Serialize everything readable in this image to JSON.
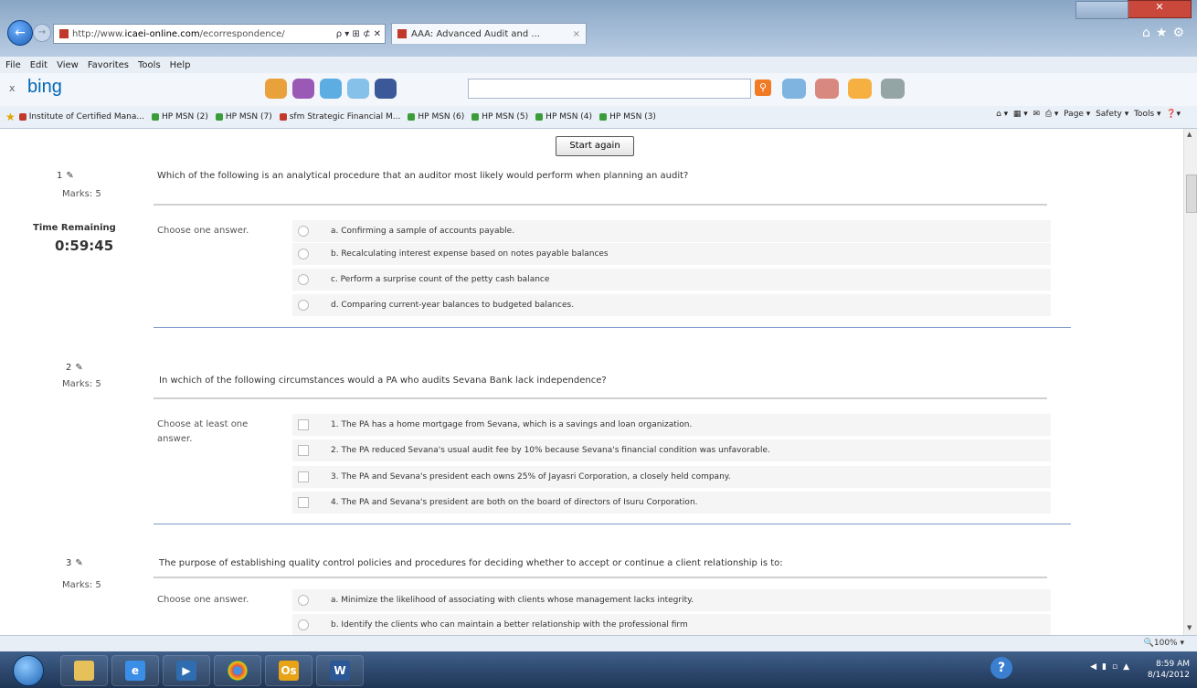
{
  "browser": {
    "url_prefix": "http://www.",
    "url_domain": "icaei-online.com",
    "url_path": "/ecorrespondence/",
    "url_controls": "ρ ▾ ⊞ ⊄ ✕",
    "tab_title": "AAA: Advanced Audit and ...",
    "tab_close": "×"
  },
  "menu": [
    "File",
    "Edit",
    "View",
    "Favorites",
    "Tools",
    "Help"
  ],
  "bing": {
    "logo": "bing",
    "close": "x"
  },
  "favorites": [
    {
      "label": "Institute of Certified Mana...",
      "color": "red"
    },
    {
      "label": "HP MSN (2)",
      "color": "green"
    },
    {
      "label": "HP MSN (7)",
      "color": "green"
    },
    {
      "label": "sfm Strategic Financial M...",
      "color": "red"
    },
    {
      "label": "HP MSN (6)",
      "color": "green"
    },
    {
      "label": "HP MSN (5)",
      "color": "green"
    },
    {
      "label": "HP MSN (4)",
      "color": "green"
    },
    {
      "label": "HP MSN (3)",
      "color": "green"
    }
  ],
  "command_bar": {
    "page": "Page ▾",
    "safety": "Safety ▾",
    "tools": "Tools ▾"
  },
  "quiz": {
    "start_again": "Start again",
    "timer_label": "Time Remaining",
    "timer_value": "0:59:45",
    "questions": [
      {
        "number": "1",
        "marks": "Marks: 5",
        "text": "Which of the following is an analytical procedure that an auditor most likely would perform when planning an audit?",
        "instruction": "Choose one answer.",
        "type": "radio",
        "options": [
          "a. Confirming a sample of accounts payable.",
          "b. Recalculating interest expense based on notes payable balances",
          "c. Perform a surprise count of the petty cash balance",
          "d. Comparing current-year balances to budgeted balances."
        ]
      },
      {
        "number": "2",
        "marks": "Marks: 5",
        "text": "In wchich of the following circumstances would a PA who audits Sevana Bank lack independence?",
        "instruction": "Choose at least one answer.",
        "type": "checkbox",
        "options": [
          "1. The PA has a home mortgage from Sevana, which is a savings and loan organization.",
          "2. The PA reduced Sevana's usual audit fee by 10% because Sevana's financial condition was unfavorable.",
          "3. The PA and Sevana's president each owns 25% of Jayasri Corporation, a closely held company.",
          "4. The PA and Sevana's president are both on the board of directors of Isuru Corporation."
        ]
      },
      {
        "number": "3",
        "marks": "Marks: 5",
        "text": "The purpose of establishing quality control policies and procedures for deciding whether to accept or continue a client relationship is to:",
        "instruction": "Choose one answer.",
        "type": "radio",
        "options": [
          "a. Minimize the likelihood of associating with clients whose management lacks integrity.",
          "b. Identify the clients who can maintain a better relationship with the professional firm"
        ]
      }
    ]
  },
  "status": {
    "zoom": "100%"
  },
  "taskbar": {
    "outlook": "Os",
    "word": "W",
    "time": "8:59 AM",
    "date": "8/14/2012",
    "help": "?"
  }
}
